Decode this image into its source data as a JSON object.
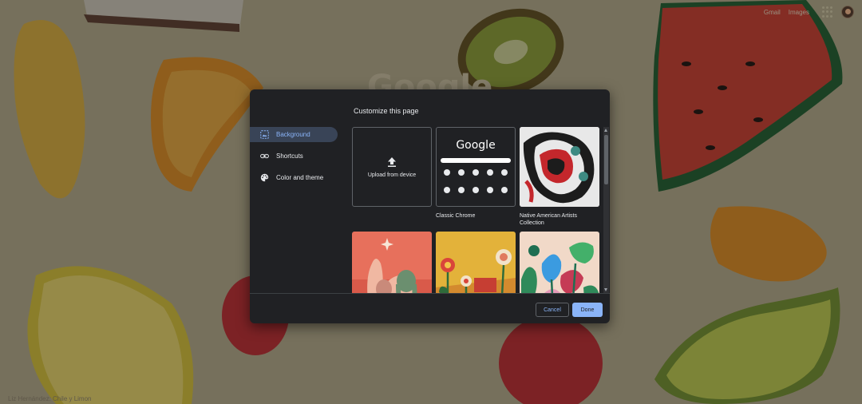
{
  "header": {
    "links": [
      "Gmail",
      "Images"
    ],
    "apps_icon": "apps-grid-icon",
    "avatar": "account-avatar"
  },
  "background_page": {
    "logo_text": "Google",
    "attribution": "Liz Hernández: Chile y Limon"
  },
  "dialog": {
    "title": "Customize this page",
    "nav": [
      {
        "label": "Background",
        "icon": "image-icon",
        "active": true
      },
      {
        "label": "Shortcuts",
        "icon": "link-icon",
        "active": false
      },
      {
        "label": "Color and theme",
        "icon": "palette-icon",
        "active": false
      }
    ],
    "tiles": {
      "upload_label": "Upload from device",
      "classic_logo": "Google",
      "classic_caption": "Classic Chrome",
      "collection_caption": "Native American Artists Collection"
    },
    "buttons": {
      "cancel": "Cancel",
      "done": "Done"
    }
  },
  "colors": {
    "dialog_bg": "#202124",
    "accent": "#8ab4f8",
    "nav_active_bg": "#394457",
    "text": "#e8eaed"
  }
}
